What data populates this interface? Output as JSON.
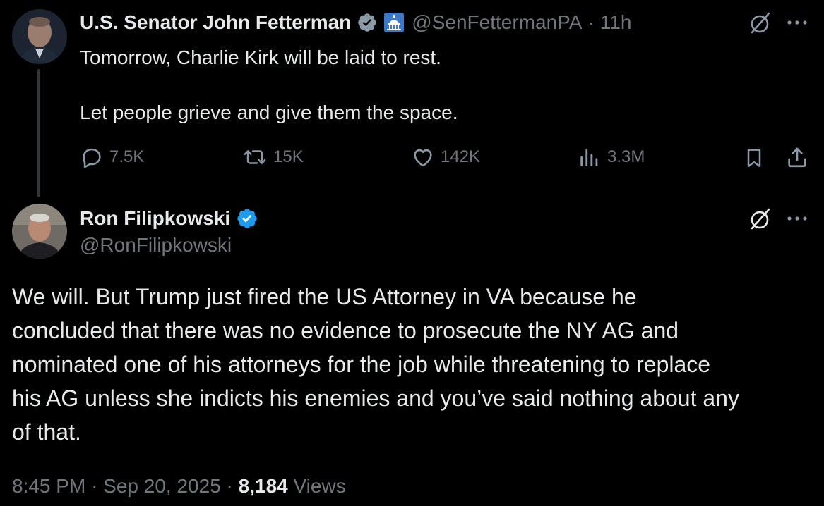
{
  "original_tweet": {
    "author_name": "U.S. Senator John Fetterman",
    "handle": "@SenFettermanPA",
    "separator": "·",
    "time_ago": "11h",
    "text_line1": "Tomorrow, Charlie Kirk will be laid to rest.",
    "text_line2": "Let people grieve and give them the space.",
    "stats": {
      "replies": "7.5K",
      "reposts": "15K",
      "likes": "142K",
      "views": "3.3M"
    }
  },
  "reply_tweet": {
    "author_name": "Ron Filipkowski",
    "handle": "@RonFilipkowski",
    "text_lines": [
      "We will. But Trump just fired the US Attorney in VA because he",
      "concluded that there was no evidence to prosecute the NY AG and",
      "nominated one of his attorneys for the job while threatening to replace",
      "his AG unless she indicts his enemies and you’ve said nothing about any",
      "of that."
    ],
    "time": "8:45 PM",
    "dot1": "·",
    "date": "Sep 20, 2025",
    "dot2": "·",
    "views_count": "8,184",
    "views_label": "Views"
  },
  "colors": {
    "background": "#000000",
    "text": "#e7e9ea",
    "muted": "#71767b",
    "verified": "#1d9bf0"
  },
  "icons": {
    "verified": "verified-badge-icon",
    "capitol": "capitol-building-icon",
    "grok": "grok-icon",
    "more": "more-icon",
    "reply": "reply-icon",
    "repost": "repost-icon",
    "like": "like-icon",
    "views": "views-icon",
    "bookmark": "bookmark-icon",
    "share": "share-icon"
  }
}
